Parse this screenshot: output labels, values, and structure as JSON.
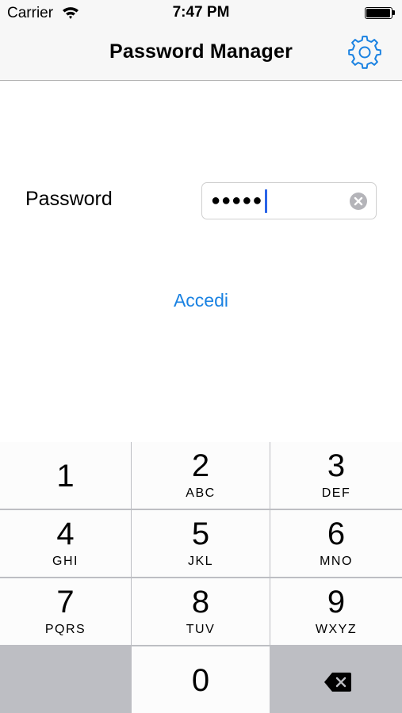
{
  "status_bar": {
    "carrier": "Carrier",
    "time": "7:47 PM",
    "wifi_icon": "wifi-icon",
    "battery_icon": "battery-icon"
  },
  "nav_bar": {
    "title": "Password Manager",
    "settings_icon": "gear-icon"
  },
  "form": {
    "password_label": "Password",
    "password_value": "●●●●●",
    "clear_icon": "clear-icon",
    "login_label": "Accedi"
  },
  "colors": {
    "accent": "#1a82e2",
    "caret": "#2a64e8",
    "keypad_background": "#bdbec3",
    "key_background": "#fcfcfc"
  },
  "keypad": {
    "keys": [
      {
        "digit": "1",
        "letters": ""
      },
      {
        "digit": "2",
        "letters": "ABC"
      },
      {
        "digit": "3",
        "letters": "DEF"
      },
      {
        "digit": "4",
        "letters": "GHI"
      },
      {
        "digit": "5",
        "letters": "JKL"
      },
      {
        "digit": "6",
        "letters": "MNO"
      },
      {
        "digit": "7",
        "letters": "PQRS"
      },
      {
        "digit": "8",
        "letters": "TUV"
      },
      {
        "digit": "9",
        "letters": "WXYZ"
      }
    ],
    "zero": "0",
    "backspace_icon": "backspace-icon"
  }
}
